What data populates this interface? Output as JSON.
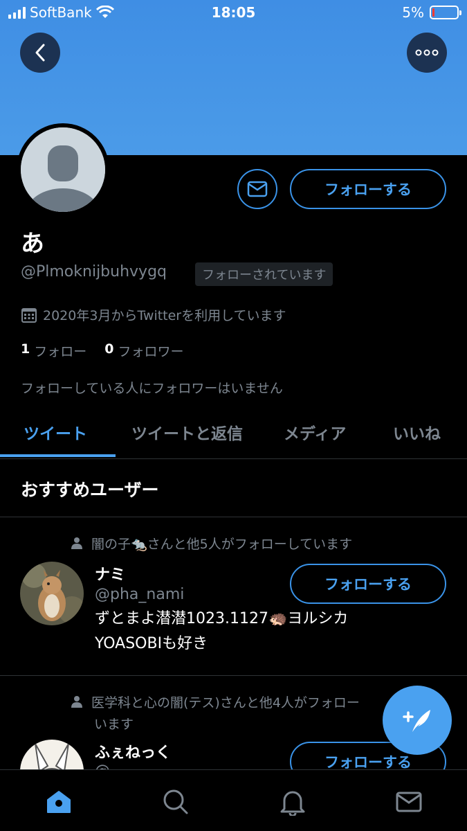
{
  "status_bar": {
    "carrier": "SoftBank",
    "time": "18:05",
    "battery": "5%"
  },
  "profile": {
    "name": "あ",
    "handle": "@Plmoknijbuhvygq",
    "follows_you": "フォローされています",
    "joined": "2020年3月からTwitterを利用しています",
    "following_count": "1",
    "following_label": "フォロー",
    "followers_count": "0",
    "followers_label": "フォロワー",
    "followers_note": "フォローしている人にフォロワーはいません",
    "follow_label": "フォローする"
  },
  "tabs": [
    {
      "label": "ツイート",
      "active": true
    },
    {
      "label": "ツイートと返信",
      "active": false
    },
    {
      "label": "メディア",
      "active": false
    },
    {
      "label": "いいね",
      "active": false
    }
  ],
  "recommended": {
    "title": "おすすめユーザー",
    "users": [
      {
        "social_context": "闇の子🐀さんと他5人がフォローしています",
        "name": "ナミ",
        "handle": "@pha_nami",
        "bio_line1": "ずとまよ潜潜1023.1127🦔ヨルシカ",
        "bio_line2": "YOASOBIも好き",
        "follow_label": "フォローする"
      },
      {
        "social_context_line1": "医学科と心の闇(テス)さんと他4人がフォロー",
        "social_context_line2": "います",
        "name": "ふぇねっく",
        "handle": "@",
        "follow_label": "フォローする"
      }
    ]
  },
  "colors": {
    "accent": "#4aa1f0",
    "banner": "#4b9be8",
    "muted": "#7d8690"
  },
  "icons": {
    "back": "chevron-left-icon",
    "more": "ellipsis-icon",
    "message": "envelope-icon",
    "calendar": "calendar-icon",
    "compose": "compose-tweet-icon",
    "nav": [
      "home-icon",
      "search-icon",
      "bell-icon",
      "mail-icon"
    ]
  }
}
